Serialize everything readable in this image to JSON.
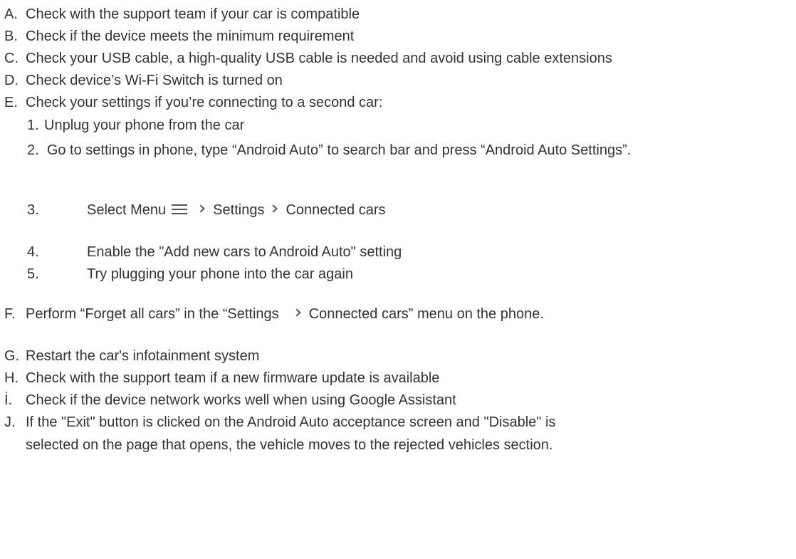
{
  "items": [
    {
      "marker": "A.",
      "text": "Check with the support team if your car is compatible"
    },
    {
      "marker": "B.",
      "text": "Check if the device meets the minimum requirement"
    },
    {
      "marker": "C.",
      "text": "Check your USB cable, a high-quality USB cable is needed and avoid using cable extensions"
    },
    {
      "marker": "D.",
      "text": "Check device’s Wi-Fi Switch is turned on"
    },
    {
      "marker": "E.",
      "text": "Check your settings if you’re connecting to a second car:"
    }
  ],
  "substeps": {
    "s1": {
      "marker": "1.",
      "text": "Unplug your phone from the car"
    },
    "s2": {
      "marker": "2.",
      "text": "Go to settings in phone, type “Android Auto” to search bar and press “Android Auto Settings”."
    },
    "s3": {
      "marker": "3.",
      "part1": "Select Menu",
      "part2": "Settings",
      "part3": "Connected cars"
    },
    "s4": {
      "marker": "4.",
      "text": "Enable the \"Add new cars to Android Auto\" setting"
    },
    "s5": {
      "marker": "5.",
      "text": "Try plugging your phone into the car again"
    }
  },
  "item_f": {
    "marker": "F.",
    "part1": "Perform “Forget all cars” in the “Settings",
    "part2": "Connected cars” menu on the phone."
  },
  "items2": [
    {
      "marker": "G.",
      "text": "Restart the car's infotainment system"
    },
    {
      "marker": "H.",
      "text": "Check with the support team if a new firmware update is available"
    },
    {
      "marker": "İ.",
      "text": "Check if the device network works well when using Google Assistant"
    }
  ],
  "item_j": {
    "marker": "J.",
    "line1": "If the \"Exit\" button is clicked on the Android Auto acceptance screen and \"Disable\" is",
    "line2": "selected on the page that opens, the vehicle moves to the rejected vehicles section."
  },
  "icons": {
    "menu": "menu-icon",
    "chevron": "chevron-right-icon"
  }
}
